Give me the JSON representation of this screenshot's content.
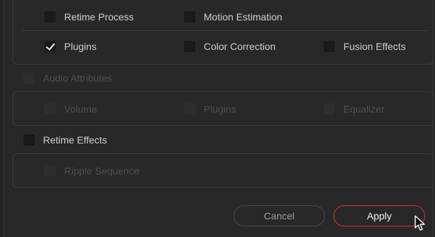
{
  "video": {
    "row1": [
      {
        "label": "Retime Process",
        "checked": false,
        "enabled": true
      },
      {
        "label": "Motion Estimation",
        "checked": false,
        "enabled": true
      }
    ],
    "row2": [
      {
        "label": "Plugins",
        "checked": true,
        "enabled": true
      },
      {
        "label": "Color Correction",
        "checked": false,
        "enabled": true
      },
      {
        "label": "Fusion Effects",
        "checked": false,
        "enabled": true
      }
    ]
  },
  "audio": {
    "header": {
      "label": "Audio Attributes",
      "checked": false,
      "enabled": false
    },
    "options": [
      {
        "label": "Volume",
        "checked": false,
        "enabled": false
      },
      {
        "label": "Plugins",
        "checked": false,
        "enabled": false
      },
      {
        "label": "Equalizer",
        "checked": false,
        "enabled": false
      }
    ]
  },
  "retime": {
    "header": {
      "label": "Retime Effects",
      "checked": false,
      "enabled": true
    },
    "options": [
      {
        "label": "Ripple Sequence",
        "checked": false,
        "enabled": false
      }
    ]
  },
  "buttons": {
    "cancel": "Cancel",
    "apply": "Apply"
  },
  "colors": {
    "background": "#28282a",
    "apply_border": "#d23232",
    "checkbox": "#1a1a1b"
  },
  "icons": {
    "check": "checkmark-icon",
    "cursor": "mouse-pointer-icon"
  }
}
